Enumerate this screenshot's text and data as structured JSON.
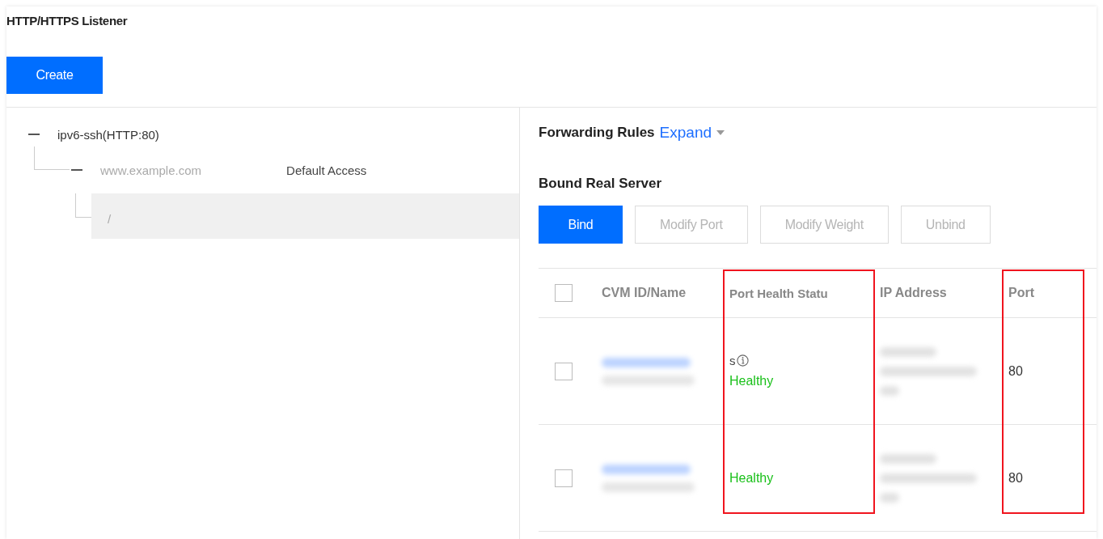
{
  "header": {
    "title": "HTTP/HTTPS Listener",
    "create_button": "Create"
  },
  "tree": {
    "label": "ipv6-ssh(HTTP:80)",
    "expanded": true,
    "children": [
      {
        "label": "www.example.com",
        "note": "Default Access",
        "expanded": true,
        "selected": false,
        "children": [
          {
            "label": "/",
            "selected": true
          }
        ]
      }
    ]
  },
  "forwarding_rules": {
    "title": "Forwarding Rules",
    "toggle": "Expand"
  },
  "bound_server": {
    "title": "Bound Real Server",
    "buttons": [
      {
        "label": "Bind",
        "disabled": false
      },
      {
        "label": "Modify Port",
        "disabled": true
      },
      {
        "label": "Modify Weight",
        "disabled": true
      },
      {
        "label": "Unbind",
        "disabled": true
      }
    ]
  },
  "table": {
    "columns": [
      {
        "label": "CVM ID/Name",
        "highlighted": false
      },
      {
        "label": "Port Health Statu",
        "highlighted": true
      },
      {
        "label": "IP Address",
        "highlighted": false
      },
      {
        "label": "Port",
        "highlighted": true
      }
    ],
    "select_all_checked": false,
    "rows": [
      {
        "checked": false,
        "health_note": "s",
        "health": "Healthy",
        "port": "80"
      },
      {
        "checked": false,
        "health": "Healthy",
        "port": "80"
      }
    ]
  }
}
